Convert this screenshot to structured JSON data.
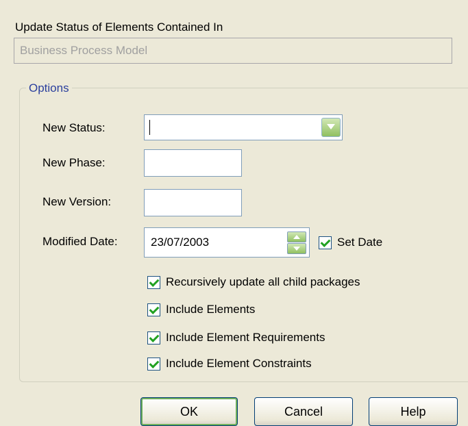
{
  "header": {
    "label": "Update Status of Elements Contained In",
    "package_name": "Business Process Model"
  },
  "options": {
    "legend": "Options",
    "new_status_label": "New Status:",
    "new_status_value": "",
    "new_phase_label": "New Phase:",
    "new_phase_value": "",
    "new_version_label": "New Version:",
    "new_version_value": "",
    "modified_date_label": "Modified Date:",
    "modified_date_value": "23/07/2003",
    "set_date_label": "Set Date",
    "recursive_label": "Recursively update all child packages",
    "include_elements_label": "Include Elements",
    "include_requirements_label": "Include Element Requirements",
    "include_constraints_label": "Include Element Constraints"
  },
  "buttons": {
    "ok": "OK",
    "cancel": "Cancel",
    "help": "Help"
  },
  "colors": {
    "background": "#ece9d8",
    "legend_text": "#2a3f9d",
    "check_mark": "#21a121"
  }
}
